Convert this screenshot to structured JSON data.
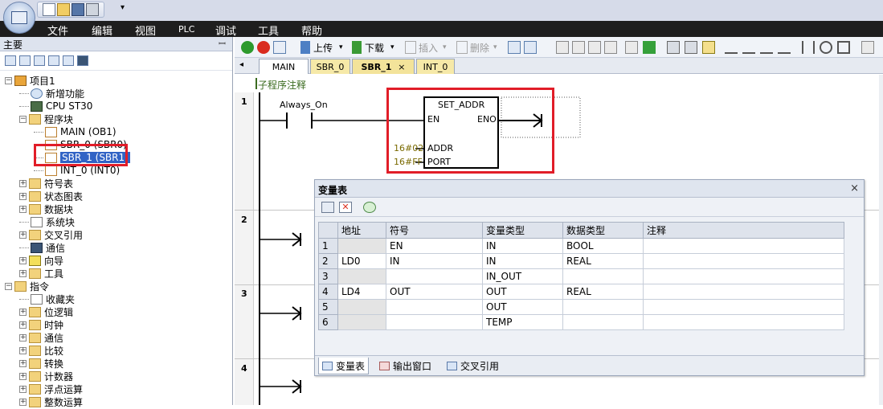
{
  "menu": [
    "文件",
    "编辑",
    "视图",
    "PLC",
    "调试",
    "工具",
    "帮助"
  ],
  "left_panel": {
    "title": "主要",
    "tree": [
      {
        "label": "项目1",
        "indent": 0,
        "expander": "−",
        "icon": "ic-book"
      },
      {
        "label": "新增功能",
        "indent": 1,
        "expander": "",
        "icon": "ic-help"
      },
      {
        "label": "CPU ST30",
        "indent": 1,
        "expander": "",
        "icon": "ic-cpu"
      },
      {
        "label": "程序块",
        "indent": 1,
        "expander": "−",
        "icon": "ic-folder"
      },
      {
        "label": "MAIN (OB1)",
        "indent": 2,
        "expander": "",
        "icon": "ic-lad"
      },
      {
        "label": "SBR_0 (SBR0)",
        "indent": 2,
        "expander": "",
        "icon": "ic-lad"
      },
      {
        "label": "SBR_1 (SBR1)",
        "indent": 2,
        "expander": "",
        "icon": "ic-lad",
        "selected": true
      },
      {
        "label": "INT_0 (INT0)",
        "indent": 2,
        "expander": "",
        "icon": "ic-lad"
      },
      {
        "label": "符号表",
        "indent": 1,
        "expander": "+",
        "icon": "ic-folder"
      },
      {
        "label": "状态图表",
        "indent": 1,
        "expander": "+",
        "icon": "ic-folder"
      },
      {
        "label": "数据块",
        "indent": 1,
        "expander": "+",
        "icon": "ic-folder"
      },
      {
        "label": "系统块",
        "indent": 1,
        "expander": "",
        "icon": "ic-doc"
      },
      {
        "label": "交叉引用",
        "indent": 1,
        "expander": "+",
        "icon": "ic-folder"
      },
      {
        "label": "通信",
        "indent": 1,
        "expander": "",
        "icon": "ic-monitor"
      },
      {
        "label": "向导",
        "indent": 1,
        "expander": "+",
        "icon": "ic-wand"
      },
      {
        "label": "工具",
        "indent": 1,
        "expander": "+",
        "icon": "ic-folder"
      },
      {
        "label": "指令",
        "indent": 0,
        "expander": "−",
        "icon": "ic-folder"
      },
      {
        "label": "收藏夹",
        "indent": 1,
        "expander": "",
        "icon": "ic-doc"
      },
      {
        "label": "位逻辑",
        "indent": 1,
        "expander": "+",
        "icon": "ic-folder"
      },
      {
        "label": "时钟",
        "indent": 1,
        "expander": "+",
        "icon": "ic-folder"
      },
      {
        "label": "通信",
        "indent": 1,
        "expander": "+",
        "icon": "ic-folder"
      },
      {
        "label": "比较",
        "indent": 1,
        "expander": "+",
        "icon": "ic-folder"
      },
      {
        "label": "转换",
        "indent": 1,
        "expander": "+",
        "icon": "ic-folder"
      },
      {
        "label": "计数器",
        "indent": 1,
        "expander": "+",
        "icon": "ic-folder"
      },
      {
        "label": "浮点运算",
        "indent": 1,
        "expander": "+",
        "icon": "ic-folder"
      },
      {
        "label": "整数运算",
        "indent": 1,
        "expander": "+",
        "icon": "ic-folder"
      }
    ]
  },
  "toolbar": {
    "upload_label": "上传",
    "download_label": "下载",
    "insert_label": "插入",
    "delete_label": "删除"
  },
  "tabs": [
    {
      "label": "MAIN"
    },
    {
      "label": "SBR_0"
    },
    {
      "label": "SBR_1",
      "active": true,
      "close": "×"
    },
    {
      "label": "INT_0"
    }
  ],
  "editor": {
    "comment": "子程序注释",
    "rung_numbers": [
      "1",
      "2",
      "3",
      "4"
    ],
    "contact_label": "Always_On",
    "block": {
      "title": "SET_ADDR",
      "en": "EN",
      "eno": "ENO",
      "addr_pin": "ADDR",
      "port_pin": "PORT",
      "addr_value": "16#02",
      "port_value": "16#FF"
    }
  },
  "var_table": {
    "title": "变量表",
    "close": "×",
    "headers": [
      "",
      "地址",
      "符号",
      "变量类型",
      "数据类型",
      "注释"
    ],
    "rows": [
      [
        "1",
        "",
        "EN",
        "IN",
        "BOOL",
        ""
      ],
      [
        "2",
        "LD0",
        "IN",
        "IN",
        "REAL",
        ""
      ],
      [
        "3",
        "",
        "",
        "IN_OUT",
        "",
        ""
      ],
      [
        "4",
        "LD4",
        "OUT",
        "OUT",
        "REAL",
        ""
      ],
      [
        "5",
        "",
        "",
        "OUT",
        "",
        ""
      ],
      [
        "6",
        "",
        "",
        "TEMP",
        "",
        ""
      ]
    ],
    "bottom_tabs": [
      "变量表",
      "输出窗口",
      "交叉引用"
    ]
  }
}
